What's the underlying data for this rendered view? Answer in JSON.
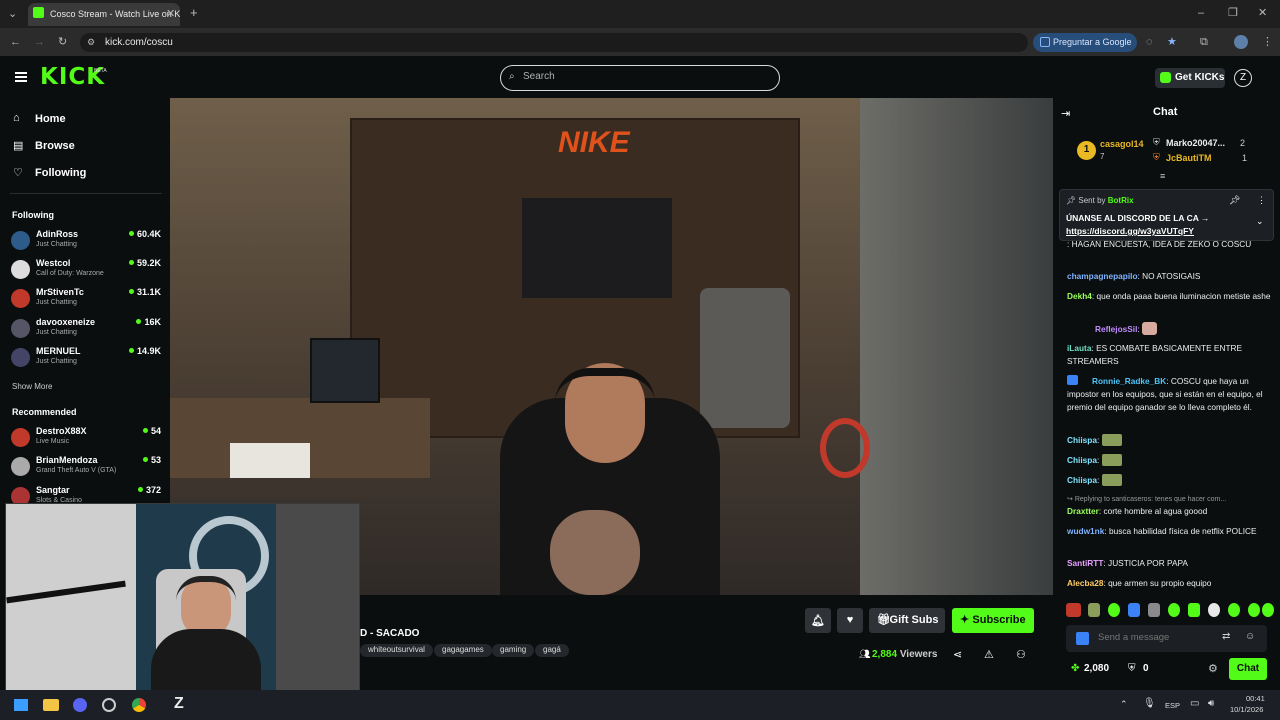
{
  "browser": {
    "tab_title": "Cosco Stream - Watch Live on K",
    "url": "kick.com/coscu",
    "google_pill": "Preguntar a Google"
  },
  "header": {
    "logo": "KICK",
    "beta": "BETA",
    "search_placeholder": "Search",
    "get_kicks": "Get KICKs"
  },
  "sidebar": {
    "nav": [
      "Home",
      "Browse",
      "Following"
    ],
    "following_title": "Following",
    "following": [
      {
        "name": "AdinRoss",
        "category": "Just Chatting",
        "viewers": "60.4K",
        "color": "#2d5b8a"
      },
      {
        "name": "Westcol",
        "category": "Call of Duty: Warzone",
        "viewers": "59.2K",
        "color": "#ddd"
      },
      {
        "name": "MrStivenTc",
        "category": "Just Chatting",
        "viewers": "31.1K",
        "color": "#c0392b"
      },
      {
        "name": "davooxeneize",
        "category": "Just Chatting",
        "viewers": "16K",
        "color": "#556"
      },
      {
        "name": "MERNUEL",
        "category": "Just Chatting",
        "viewers": "14.9K",
        "color": "#446"
      }
    ],
    "show_more": "Show More",
    "recommended_title": "Recommended",
    "recommended": [
      {
        "name": "DestroX88X",
        "category": "Live Music",
        "viewers": "54",
        "color": "#c0392b"
      },
      {
        "name": "BrianMendoza",
        "category": "Grand Theft Auto V (GTA)",
        "viewers": "53",
        "color": "#aaa"
      },
      {
        "name": "Sangtar",
        "category": "Slots & Casino",
        "viewers": "372",
        "color": "#a33"
      }
    ]
  },
  "stream": {
    "title_fragment": "D - SACADO",
    "tags": [
      "whiteoutsurvival",
      "gagagames",
      "gaming",
      "gagá"
    ],
    "gift_label": "Gift Subs",
    "subscribe_label": "Subscribe",
    "viewers": "2,884",
    "viewers_label": "Viewers"
  },
  "chat": {
    "title": "Chat",
    "leaderboard": [
      {
        "rank": "1",
        "name": "casagol14",
        "count": "7"
      },
      {
        "rank": "",
        "name": "Marko20047...",
        "count": "2"
      },
      {
        "rank": "",
        "name": "JcBautiTM",
        "count": "1"
      }
    ],
    "pinned_sender_prefix": "Sent by",
    "pinned_sender": "BotRix",
    "pinned_text": "ÚNANSE AL DISCORD DE LA CA →",
    "pinned_link": "https://discord.gg/w3yaVUTqFY",
    "messages": [
      {
        "user": "",
        "text": "HAGAN ENCUESTA, IDEA DE ZEKO O COSCU",
        "color": "#e74c3c"
      },
      {
        "user": "champagnepapilo",
        "text": "NO ATOSIGAIS",
        "color": "#7fb3ff"
      },
      {
        "user": "Dekh4",
        "text": "que onda paaa buena iluminacion metiste ashe",
        "color": "#9cff5c"
      },
      {
        "user": "ReflejosSil",
        "text": "",
        "color": "#c08cff"
      },
      {
        "user": "iLauta",
        "text": "ES COMBATE BASICAMENTE ENTRE STREAMERS",
        "color": "#6fe0c4"
      },
      {
        "user": "Ronnie_Radke_BK",
        "text": "COSCU que haya un impostor en los equipos, que si están en el equipo, el premio del equipo ganador se lo lleva completo él.",
        "color": "#4fc3f7"
      },
      {
        "user": "Chiispa",
        "text": "",
        "color": "#7fe3ff"
      },
      {
        "user": "Chiispa",
        "text": "",
        "color": "#7fe3ff"
      },
      {
        "user": "Chiispa",
        "text": "",
        "color": "#7fe3ff"
      },
      {
        "user": "Draxtter",
        "text": "corte hombre al agua goood",
        "color": "#9cff5c",
        "reply": "Replying to santicaseros: tenes que hacer com..."
      },
      {
        "user": "wudw1nk",
        "text": "busca habilidad física de netflix POLICE",
        "color": "#7fb3ff"
      },
      {
        "user": "SantiRTT",
        "text": "JUSTICIA POR PAPA",
        "color": "#e8a0ff"
      },
      {
        "user": "Alecba28",
        "text": "que armen su propio equipo",
        "color": "#ffcc66"
      }
    ],
    "input_placeholder": "Send a message",
    "points": "2,080",
    "other_count": "0",
    "send_label": "Chat"
  },
  "taskbar": {
    "lang": "ESP",
    "time": "00:41",
    "date": "10/1/2026"
  }
}
